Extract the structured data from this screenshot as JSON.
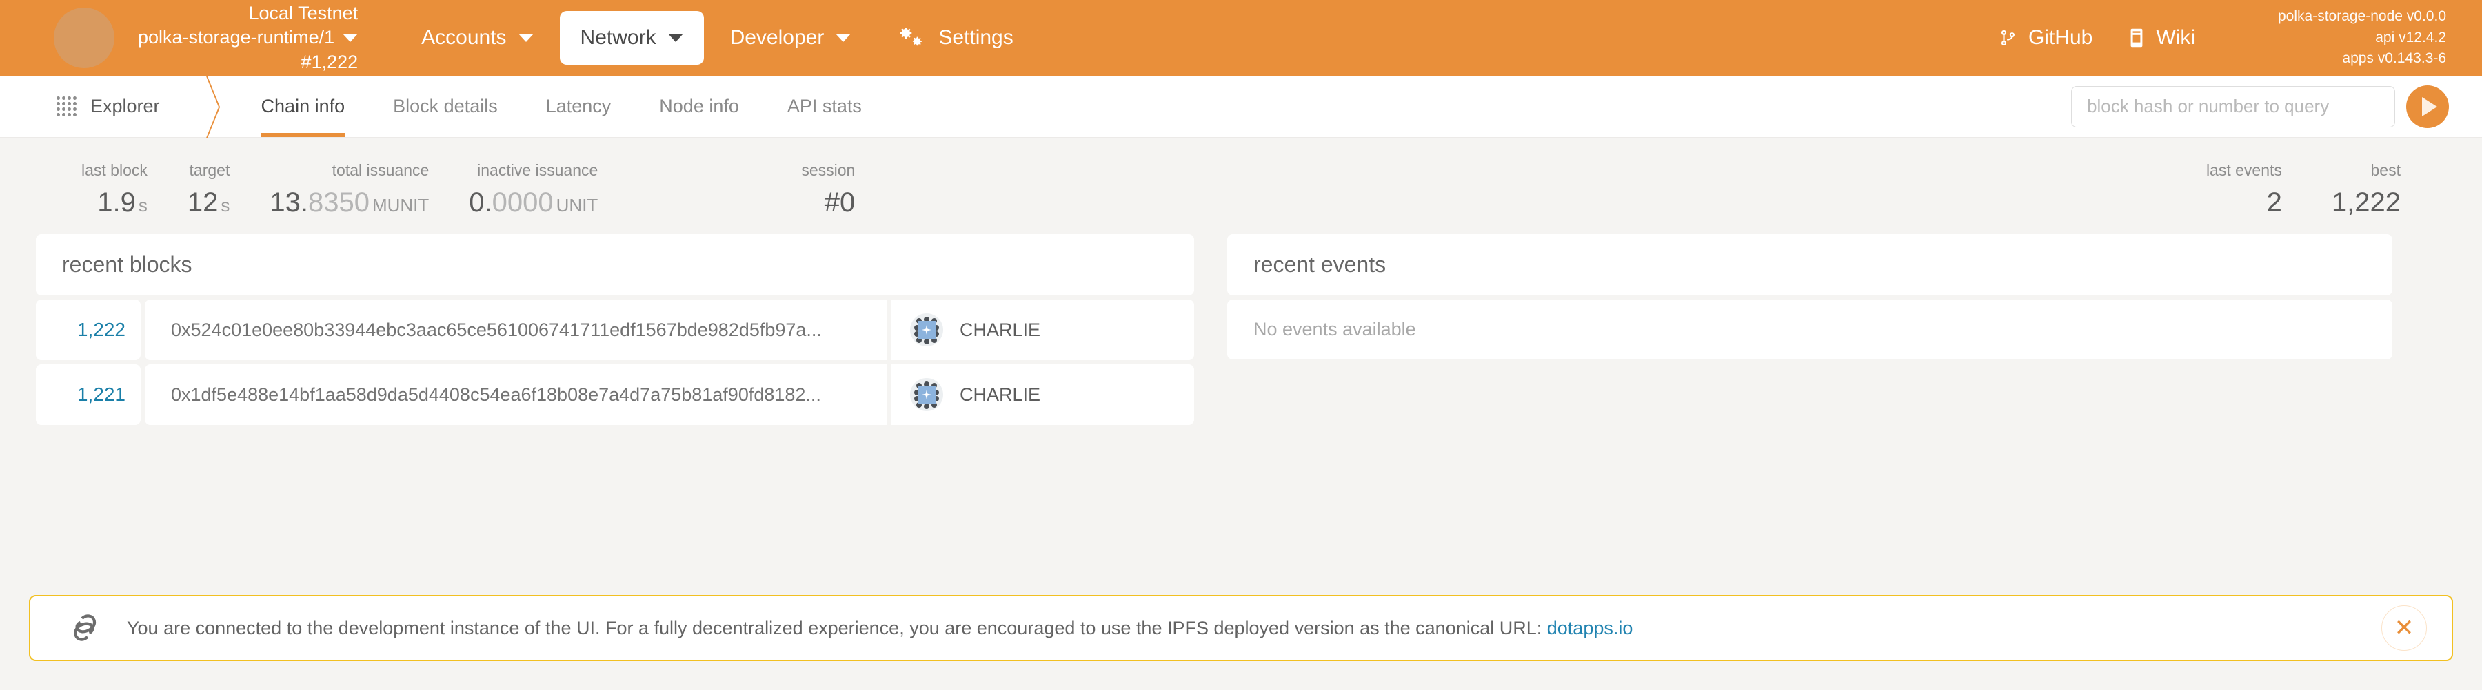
{
  "topbar": {
    "chain": {
      "name": "Local Testnet",
      "runtime": "polka-storage-runtime/1",
      "best_block": "#1,222"
    },
    "menu": [
      {
        "label": "Accounts",
        "icon": "chevron-down-icon",
        "active": false
      },
      {
        "label": "Network",
        "icon": "chevron-down-icon",
        "active": true
      },
      {
        "label": "Developer",
        "icon": "chevron-down-icon",
        "active": false
      },
      {
        "label": "Settings",
        "icon": "gear-icon",
        "active": false
      }
    ],
    "external_links": [
      {
        "label": "GitHub",
        "icon": "git-branch-icon"
      },
      {
        "label": "Wiki",
        "icon": "book-icon"
      }
    ],
    "versions": {
      "node": "polka-storage-node v0.0.0",
      "api": "api v12.4.2",
      "apps": "apps v0.143.3-6"
    }
  },
  "navbar": {
    "section": "Explorer",
    "section_icon": "grid-dots-icon",
    "tabs": [
      {
        "label": "Chain info",
        "active": true
      },
      {
        "label": "Block details",
        "active": false
      },
      {
        "label": "Latency",
        "active": false
      },
      {
        "label": "Node info",
        "active": false
      },
      {
        "label": "API stats",
        "active": false
      }
    ],
    "search": {
      "placeholder": "block hash or number to query",
      "value": "",
      "submit_icon": "play-icon"
    }
  },
  "summary": {
    "last_block": {
      "label": "last block",
      "value": "1.9",
      "unit": "s"
    },
    "target": {
      "label": "target",
      "value": "12",
      "unit": "s"
    },
    "total_issuance": {
      "label": "total issuance",
      "whole": "13.",
      "fraction": "8350",
      "unit": "MUNIT"
    },
    "inactive_issuance": {
      "label": "inactive issuance",
      "whole": "0.",
      "fraction": "0000",
      "unit": "UNIT"
    },
    "session": {
      "label": "session",
      "value": "#0"
    },
    "last_events": {
      "label": "last events",
      "value": "2"
    },
    "best": {
      "label": "best",
      "value": "1,222"
    }
  },
  "recent_blocks": {
    "title": "recent blocks",
    "rows": [
      {
        "number": "1,222",
        "hash": "0x524c01e0ee80b33944ebc3aac65ce561006741711edf1567bde982d5fb97a...",
        "author": "CHARLIE"
      },
      {
        "number": "1,221",
        "hash": "0x1df5e488e14bf1aa58d9da5d4408c54ea6f18b08e7a4d7a75b81af90fd8182...",
        "author": "CHARLIE"
      }
    ]
  },
  "recent_events": {
    "title": "recent events",
    "empty_text": "No events available"
  },
  "banner": {
    "icon": "link-chain-icon",
    "text_before": "You are connected to the development instance of the UI. For a fully decentralized experience, you are encouraged to use the IPFS deployed version as the canonical URL: ",
    "link_label": "dotapps.io",
    "close_icon": "close-icon"
  },
  "colors": {
    "brand_orange": "#e98f3a",
    "link_blue": "#1a7fa8",
    "banner_border": "#f2c022",
    "identicon_blue": "#8cb3dd"
  }
}
